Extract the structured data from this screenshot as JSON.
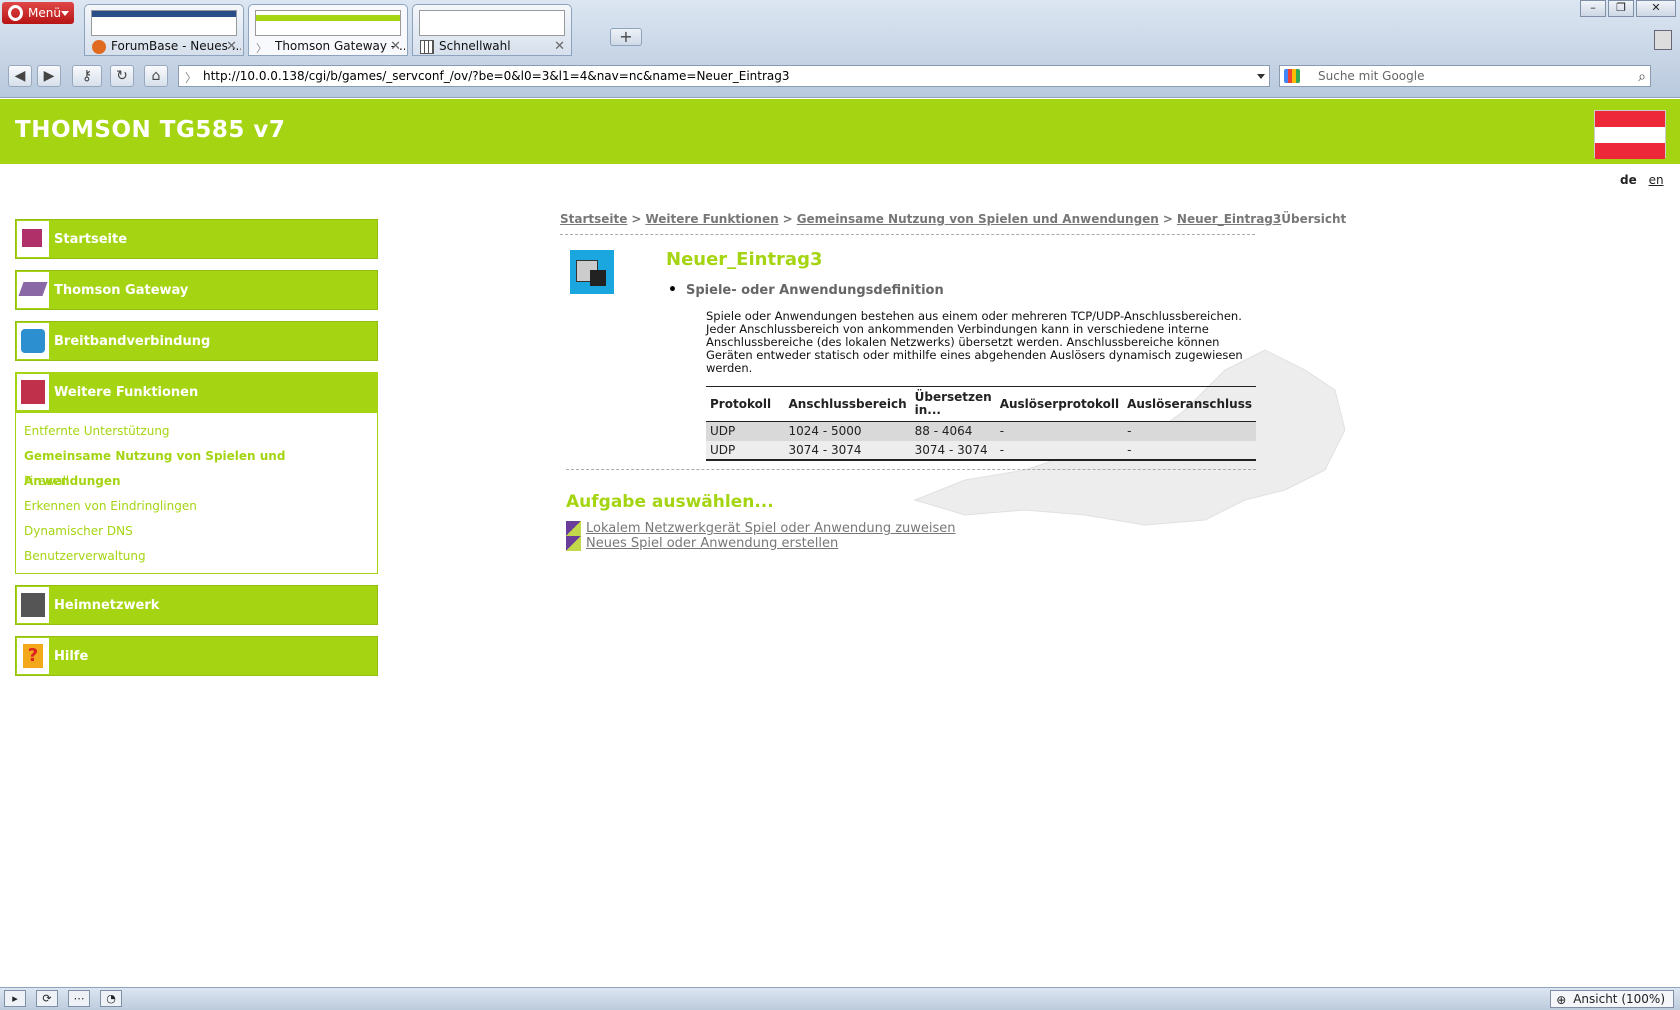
{
  "browser": {
    "menu_label": "Menü",
    "tabs": [
      {
        "label": "ForumBase - Neues ..."
      },
      {
        "label": "Thomson Gateway - ..."
      },
      {
        "label": "Schnellwahl"
      }
    ],
    "url": "http://10.0.0.138/cgi/b/games/_servconf_/ov/?be=0&l0=3&l1=4&nav=nc&name=Neuer_Eintrag3",
    "search_placeholder": "Suche mit Google",
    "zoom_label": "Ansicht (100%)"
  },
  "header": {
    "title": "THOMSON TG585 v7",
    "flag_colors": [
      "#ed2939",
      "#ffffff",
      "#ed2939"
    ]
  },
  "lang": {
    "de": "de",
    "en": "en"
  },
  "sidebar": {
    "items": [
      {
        "label": "Startseite",
        "icon": "house-icon"
      },
      {
        "label": "Thomson Gateway",
        "icon": "gateway-icon"
      },
      {
        "label": "Breitbandverbindung",
        "icon": "globe-icon"
      },
      {
        "label": "Weitere Funktionen",
        "icon": "toolbox-icon"
      },
      {
        "label": "Heimnetzwerk",
        "icon": "network-icon"
      },
      {
        "label": "Hilfe",
        "icon": "help-icon"
      }
    ],
    "sub_items": [
      "Entfernte Unterstützung",
      "Gemeinsame Nutzung von Spielen und Anwendungen",
      "Firewall",
      "Erkennen von Eindringlingen",
      "Dynamischer DNS",
      "Benutzerverwaltung"
    ]
  },
  "breadcrumb": {
    "items": [
      "Startseite",
      "Weitere Funktionen",
      "Gemeinsame Nutzung von Spielen und Anwendungen",
      "Neuer_Eintrag3"
    ],
    "current": "Übersicht",
    "sep": ">"
  },
  "main": {
    "title": "Neuer_Eintrag3",
    "section_heading": "Spiele- oder Anwendungsdefinition",
    "description": "Spiele oder Anwendungen bestehen aus einem oder mehreren TCP/UDP-Anschlussbereichen. Jeder Anschlussbereich von ankommenden Verbindungen kann in verschiedene interne Anschlussbereiche (des lokalen Netzwerks) übersetzt werden. Anschlussbereiche können Geräten entweder statisch oder mithilfe eines abgehenden Auslösers dynamisch zugewiesen werden.",
    "table": {
      "headers": [
        "Protokoll",
        "Anschlussbereich",
        "Übersetzen in...",
        "Auslöserprotokoll",
        "Auslöseranschluss"
      ],
      "rows": [
        [
          "UDP",
          "1024 - 5000",
          "88 - 4064",
          "-",
          "-"
        ],
        [
          "UDP",
          "3074 - 3074",
          "3074 - 3074",
          "-",
          "-"
        ]
      ]
    },
    "task_title": "Aufgabe auswählen...",
    "tasks": [
      "Lokalem Netzwerkgerät Spiel oder Anwendung zuweisen",
      "Neues Spiel oder Anwendung erstellen"
    ]
  }
}
